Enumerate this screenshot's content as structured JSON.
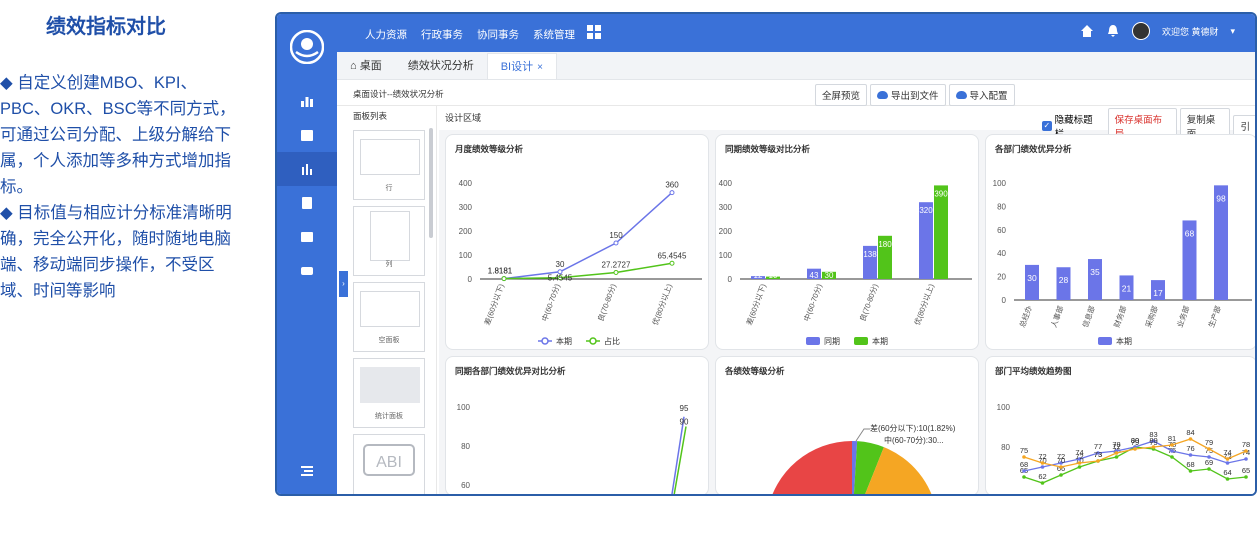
{
  "promo": {
    "title": "绩效指标对比",
    "paragraph1": "◆ 自定义创建MBO、KPI、PBC、OKR、BSC等不同方式，可通过公司分配、上级分解给下属，个人添加等多种方式增加指标。",
    "paragraph2": "◆ 目标值与相应计分标准清晰明确，完全公开化，随时随地电脑端、移动端同步操作，不受区域、时间等影响"
  },
  "topbar": {
    "nav": [
      "人力资源",
      "行政事务",
      "协同事务",
      "系统管理"
    ],
    "user": "欢迎您 黄德财"
  },
  "tabs": [
    {
      "label": "桌面",
      "icon": "home-icon"
    },
    {
      "label": "绩效状况分析"
    },
    {
      "label": "BI设计",
      "close": "×"
    }
  ],
  "crumbbar": {
    "crumb": "桌面设计--绩效状况分析",
    "buttons": [
      "全屏预览",
      "导出到文件",
      "导入配置"
    ]
  },
  "panel_list": {
    "title": "面板列表",
    "items": [
      "行",
      "列",
      "空面板",
      "统计面板"
    ]
  },
  "design": {
    "title": "设计区域",
    "hide_title": "隐藏标题栏",
    "save": "保存桌面布局",
    "copy": "复制桌面",
    "more": "引"
  },
  "colors": {
    "accent": "#3a71d8",
    "series_blue": "#6b75e8",
    "series_green": "#52c41a",
    "red": "#e84545",
    "orange": "#f5a623"
  },
  "chart_data": [
    {
      "type": "line",
      "title": "月度绩效等级分析",
      "categories": [
        "差(60分以下)",
        "中(60-70分)",
        "良(70-80分)",
        "优(80分以上)"
      ],
      "series": [
        {
          "name": "本期",
          "values": [
            1.8181,
            30,
            150,
            360
          ]
        },
        {
          "name": "占比",
          "values": [
            1.8181,
            5.4545,
            27.2727,
            65.4545
          ]
        }
      ],
      "yticks": [
        0,
        100,
        200,
        300,
        400
      ],
      "ylim": [
        0,
        400
      ]
    },
    {
      "type": "bar",
      "title": "同期绩效等级对比分析",
      "categories": [
        "差(60分以下)",
        "中(60-70分)",
        "良(70-80分)",
        "优(80分以上)"
      ],
      "series": [
        {
          "name": "同期",
          "values": [
            12,
            43,
            138,
            320
          ]
        },
        {
          "name": "本期",
          "values": [
            10,
            30,
            180,
            390
          ]
        }
      ],
      "yticks": [
        0,
        100,
        200,
        300,
        400
      ],
      "ylim": [
        0,
        400
      ]
    },
    {
      "type": "bar",
      "title": "各部门绩效优异分析",
      "categories": [
        "总经办",
        "人事部",
        "信息部",
        "财务部",
        "采购部",
        "业务部",
        "生产部"
      ],
      "series": [
        {
          "name": "本期",
          "values": [
            30,
            28,
            35,
            21,
            17,
            68,
            98
          ]
        }
      ],
      "yticks": [
        0,
        20,
        40,
        60,
        80,
        100
      ],
      "ylim": [
        0,
        100
      ]
    },
    {
      "type": "line",
      "title": "同期各部门绩效优异对比分析",
      "yticks": [
        60,
        80,
        100
      ],
      "labels": [
        "95",
        "90"
      ],
      "values": [
        95,
        90
      ]
    },
    {
      "type": "pie",
      "title": "各绩效等级分析",
      "labels": [
        "差(60分以下):10(1.82%)",
        "中(60-70分):30..."
      ]
    },
    {
      "type": "line",
      "title": "部门平均绩效趋势图",
      "yticks": [
        80,
        100
      ],
      "series": [
        {
          "name": "a",
          "values": [
            65,
            62,
            66,
            70,
            73,
            75,
            80,
            79,
            75,
            68,
            69,
            64,
            65
          ]
        },
        {
          "name": "b",
          "values": [
            68,
            70,
            72,
            74,
            77,
            78,
            80,
            83,
            78,
            76,
            75,
            72,
            74
          ]
        },
        {
          "name": "c",
          "values": [
            75,
            72,
            70,
            72,
            73,
            77,
            79,
            80,
            81,
            84,
            79,
            74,
            78
          ]
        }
      ]
    }
  ]
}
